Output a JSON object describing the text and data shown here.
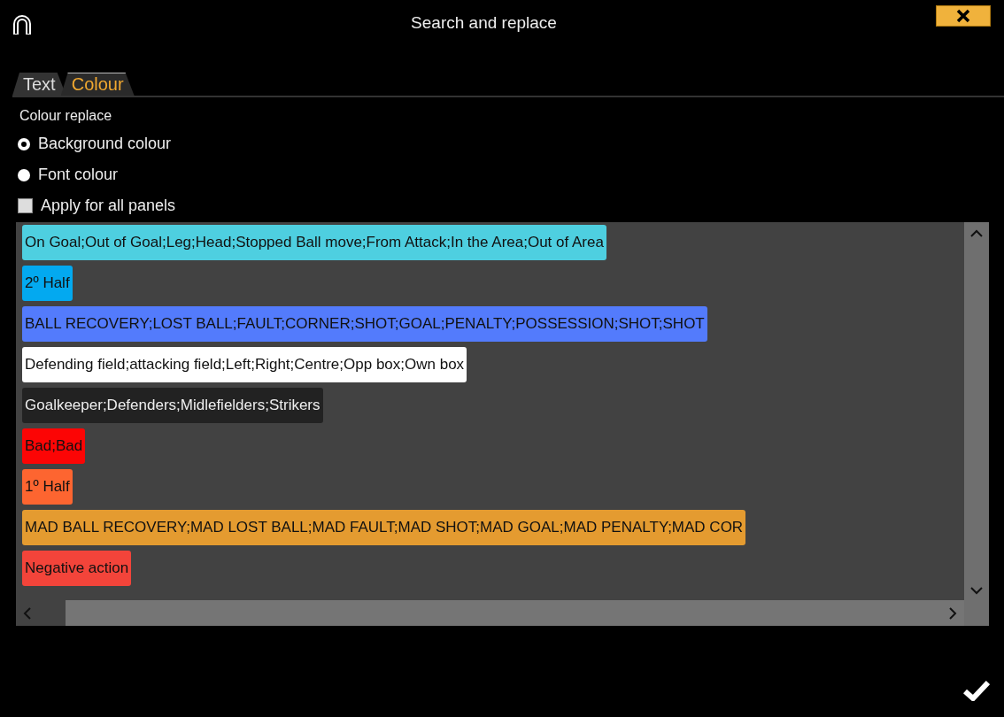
{
  "window": {
    "title": "Search and replace"
  },
  "tabs": [
    {
      "label": "Text",
      "selected": false
    },
    {
      "label": "Colour",
      "selected": true
    }
  ],
  "section_label": "Colour replace",
  "radios": [
    {
      "label": "Background colour",
      "selected": true
    },
    {
      "label": "Font colour",
      "selected": false
    }
  ],
  "apply_all": {
    "label": "Apply for all panels",
    "checked": false
  },
  "swatches": [
    {
      "text": "On Goal;Out of Goal;Leg;Head;Stopped Ball move;From Attack;In the Area;Out of Area",
      "color": "#4ecfe0"
    },
    {
      "text": "2º Half",
      "color": "#03a9f0"
    },
    {
      "text": "BALL RECOVERY;LOST BALL;FAULT;CORNER;SHOT;GOAL;PENALTY;POSSESSION;SHOT;SHOT",
      "color": "#537bfc"
    },
    {
      "text": "Defending field;attacking field;Left;Right;Centre;Opp box;Own box",
      "color": "#ffffff"
    },
    {
      "text": "Goalkeeper;Defenders;Midlefielders;Strikers",
      "color": "#222222"
    },
    {
      "text": "Bad;Bad",
      "color": "#fc0505"
    },
    {
      "text": "1º Half",
      "color": "#fd6530"
    },
    {
      "text": "MAD BALL RECOVERY;MAD LOST BALL;MAD FAULT;MAD SHOT;MAD GOAL;MAD PENALTY;MAD COR",
      "color": "#e49b30"
    },
    {
      "text": "Negative action",
      "color": "#f3443a"
    }
  ]
}
